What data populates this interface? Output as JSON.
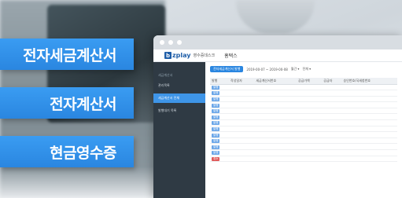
{
  "banners": [
    {
      "label": "전자세금계산서"
    },
    {
      "label": "전자계산서"
    },
    {
      "label": "현금영수증"
    }
  ],
  "app": {
    "logo_mark": "b",
    "logo_text": "zplay",
    "logo_sub": "영수증데스크",
    "menu_home": "홈택스",
    "toolbar_button": "전자세금계산서 발행",
    "toolbar_range": "2019-00-07 ~ 2019-00-08",
    "toolbar_filter1": "월간 ▾",
    "toolbar_filter2": "전체 ▾"
  },
  "sidebar": {
    "section": "세금계산서",
    "items": [
      {
        "label": "관리목록",
        "active": false
      },
      {
        "label": "세금계산서 전체",
        "active": true
      },
      {
        "label": "발행대기 목록",
        "active": false
      }
    ]
  },
  "table": {
    "columns": [
      "발행",
      "작성일자",
      "세금계산서번호",
      "공급가액",
      "공급자",
      "승인번호/국세청번호"
    ],
    "rows": [
      {
        "tag": "발행",
        "red": false
      },
      {
        "tag": "발행",
        "red": false
      },
      {
        "tag": "발행",
        "red": false
      },
      {
        "tag": "발행",
        "red": false
      },
      {
        "tag": "발행",
        "red": false
      },
      {
        "tag": "발행",
        "red": false
      },
      {
        "tag": "발행",
        "red": false
      },
      {
        "tag": "발행",
        "red": false
      },
      {
        "tag": "발행",
        "red": false
      },
      {
        "tag": "발행",
        "red": false
      },
      {
        "tag": "발행",
        "red": false
      },
      {
        "tag": "발행",
        "red": false
      },
      {
        "tag": "취소",
        "red": true
      }
    ]
  }
}
